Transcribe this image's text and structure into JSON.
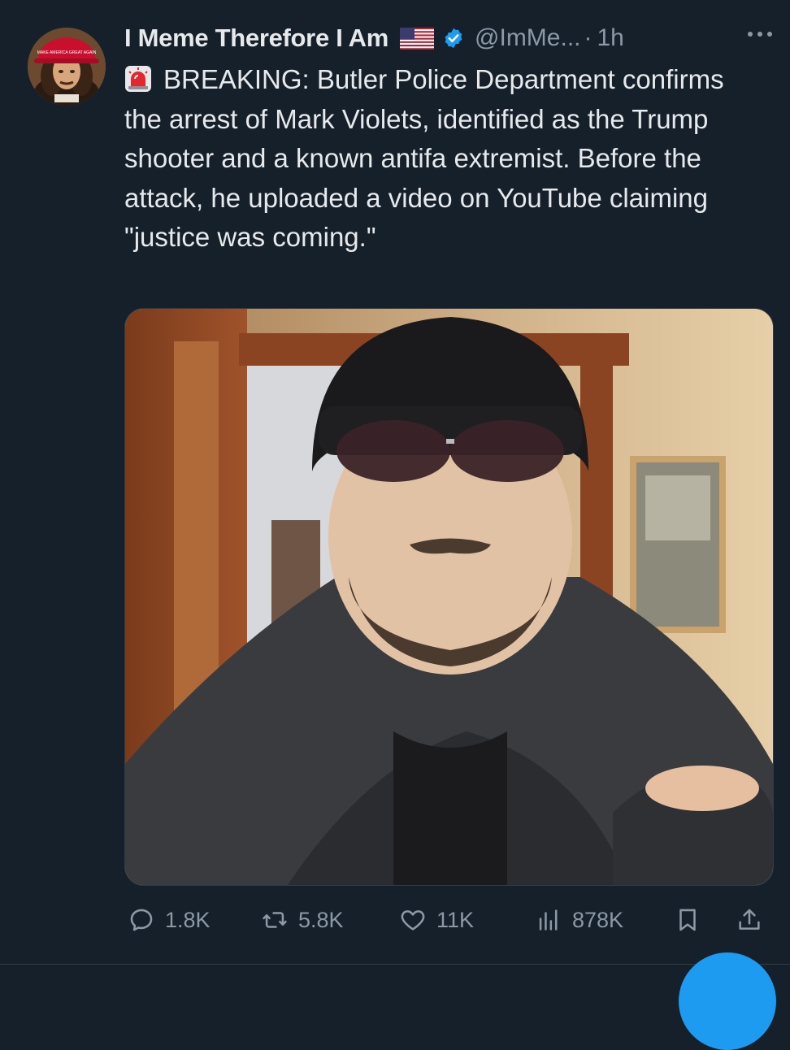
{
  "tweet": {
    "display_name": "I Meme Therefore I Am",
    "flag_icon": "us-flag-icon",
    "verified": true,
    "handle": "@ImMe...",
    "separator": "·",
    "time": "1h",
    "siren_icon": "rotating-light-icon",
    "text": "BREAKING: Butler Police Department confirms the arrest of Mark Violets, identified as the Trump shooter and a known antifa extremist. Before the attack, he uploaded a video on YouTube claiming \"justice was coming.\"",
    "avatar_hat_text": "MAKE AMERICA GREAT AGAIN"
  },
  "actions": {
    "replies": "1.8K",
    "retweets": "5.8K",
    "likes": "11K",
    "views": "878K"
  },
  "colors": {
    "background": "#15202b",
    "text": "#e7e9ea",
    "secondary": "#8b98a5",
    "accent": "#1d9bf0"
  }
}
